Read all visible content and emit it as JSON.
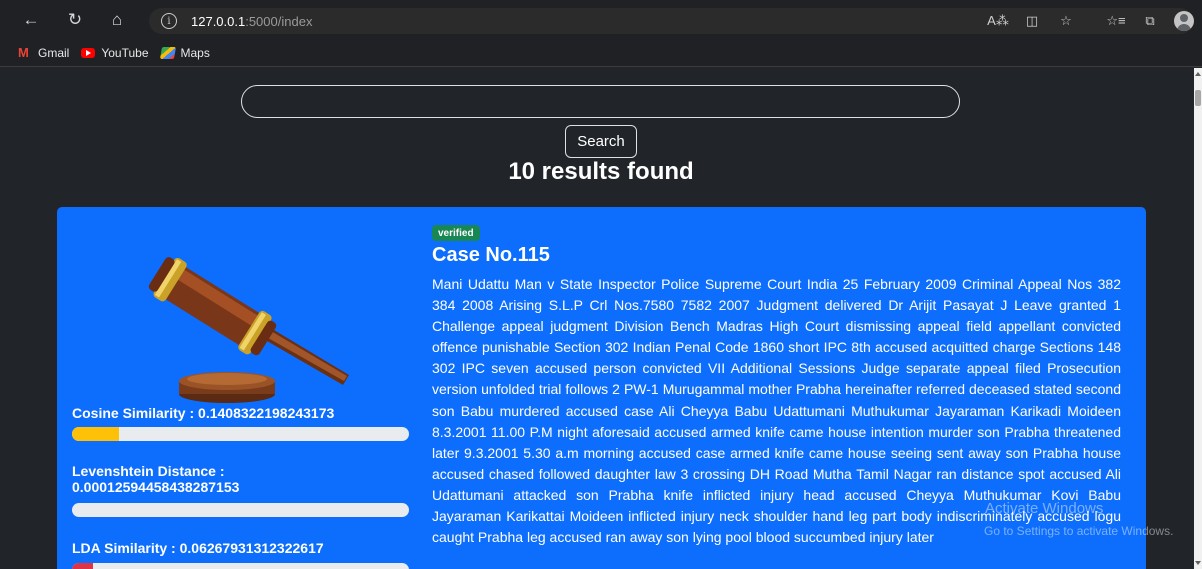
{
  "browser": {
    "url_host": "127.0.0.1",
    "url_path": ":5000/index",
    "nav": {
      "back_icon": "back-arrow-icon",
      "refresh_icon": "refresh-icon",
      "home_icon": "home-icon"
    }
  },
  "bookmarks": [
    {
      "label": "Gmail",
      "icon": "gmail-icon"
    },
    {
      "label": "YouTube",
      "icon": "youtube-icon"
    },
    {
      "label": "Maps",
      "icon": "maps-icon"
    }
  ],
  "search": {
    "value": "",
    "placeholder": "",
    "button_label": "Search"
  },
  "results": {
    "count_text": "10 results found"
  },
  "case": {
    "badge": "verified",
    "title": "Case No.115",
    "text": "Mani Udattu Man v State Inspector Police Supreme Court India 25 February 2009 Criminal Appeal Nos 382 384 2008 Arising S.L.P Crl Nos.7580 7582 2007 Judgment delivered Dr Arijit Pasayat J Leave granted 1 Challenge appeal judgment Division Bench Madras High Court dismissing appeal field appellant convicted offence punishable Section 302 Indian Penal Code 1860 short IPC 8th accused acquitted charge Sections 148 302 IPC seven accused person convicted VII Additional Sessions Judge separate appeal filed Prosecution version unfolded trial follows 2 PW-1 Murugammal mother Prabha hereinafter referred deceased stated second son Babu murdered accused case Ali Cheyya Babu Udattumani Muthukumar Jayaraman Karikadi Moideen 8.3.2001 11.00 P.M night aforesaid accused armed knife came house intention murder son Prabha threatened later 9.3.2001 5.30 a.m morning accused case armed knife came house seeing sent away son Prabha house accused chased followed daughter law 3 crossing DH Road Mutha Tamil Nagar ran distance spot accused Ali Udattumani attacked son Prabha knife inflicted injury head accused Cheyya Muthukumar Kovi Babu Jayaraman Karikattai Moideen inflicted injury neck shoulder hand leg part body indiscriminately accused logu caught Prabha leg accused ran away son lying pool blood succumbed injury later",
    "metrics": [
      {
        "label": "Cosine Similarity : 0.1408322198243173",
        "value": 0.1408322198243173,
        "color": "#ffc107"
      },
      {
        "label": "Levenshtein Distance : 0.00012594458438287153",
        "value": 0.00012594458438287153,
        "color": "#0d6efd"
      },
      {
        "label": "LDA Similarity : 0.06267931312322617",
        "value": 0.06267931312322617,
        "color": "#dc3545"
      }
    ]
  },
  "watermark": {
    "line1": "Activate Windows",
    "line2": "Go to Settings to activate Windows."
  }
}
